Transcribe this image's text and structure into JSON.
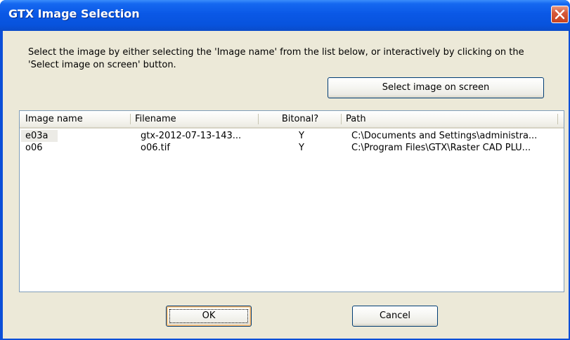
{
  "window": {
    "title": "GTX Image Selection",
    "close_icon": "close-icon",
    "title_color": "#0a58e6",
    "close_color": "#d5593b"
  },
  "dialog": {
    "instructions": "Select the image by either selecting the 'Image name' from the list below, or interactively by clicking on the 'Select image on screen' button.",
    "select_on_screen_label": "Select image on screen",
    "ok_label": "OK",
    "cancel_label": "Cancel"
  },
  "list": {
    "columns": [
      "Image name",
      "Filename",
      "Bitonal?",
      "Path"
    ],
    "rows": [
      {
        "image_name": "e03a",
        "filename": "gtx-2012-07-13-143...",
        "bitonal": "Y",
        "path": "C:\\Documents and Settings\\administra...",
        "selected": true
      },
      {
        "image_name": "o06",
        "filename": "o06.tif",
        "bitonal": "Y",
        "path": "C:\\Program Files\\GTX\\Raster CAD PLU...",
        "selected": false
      }
    ]
  }
}
